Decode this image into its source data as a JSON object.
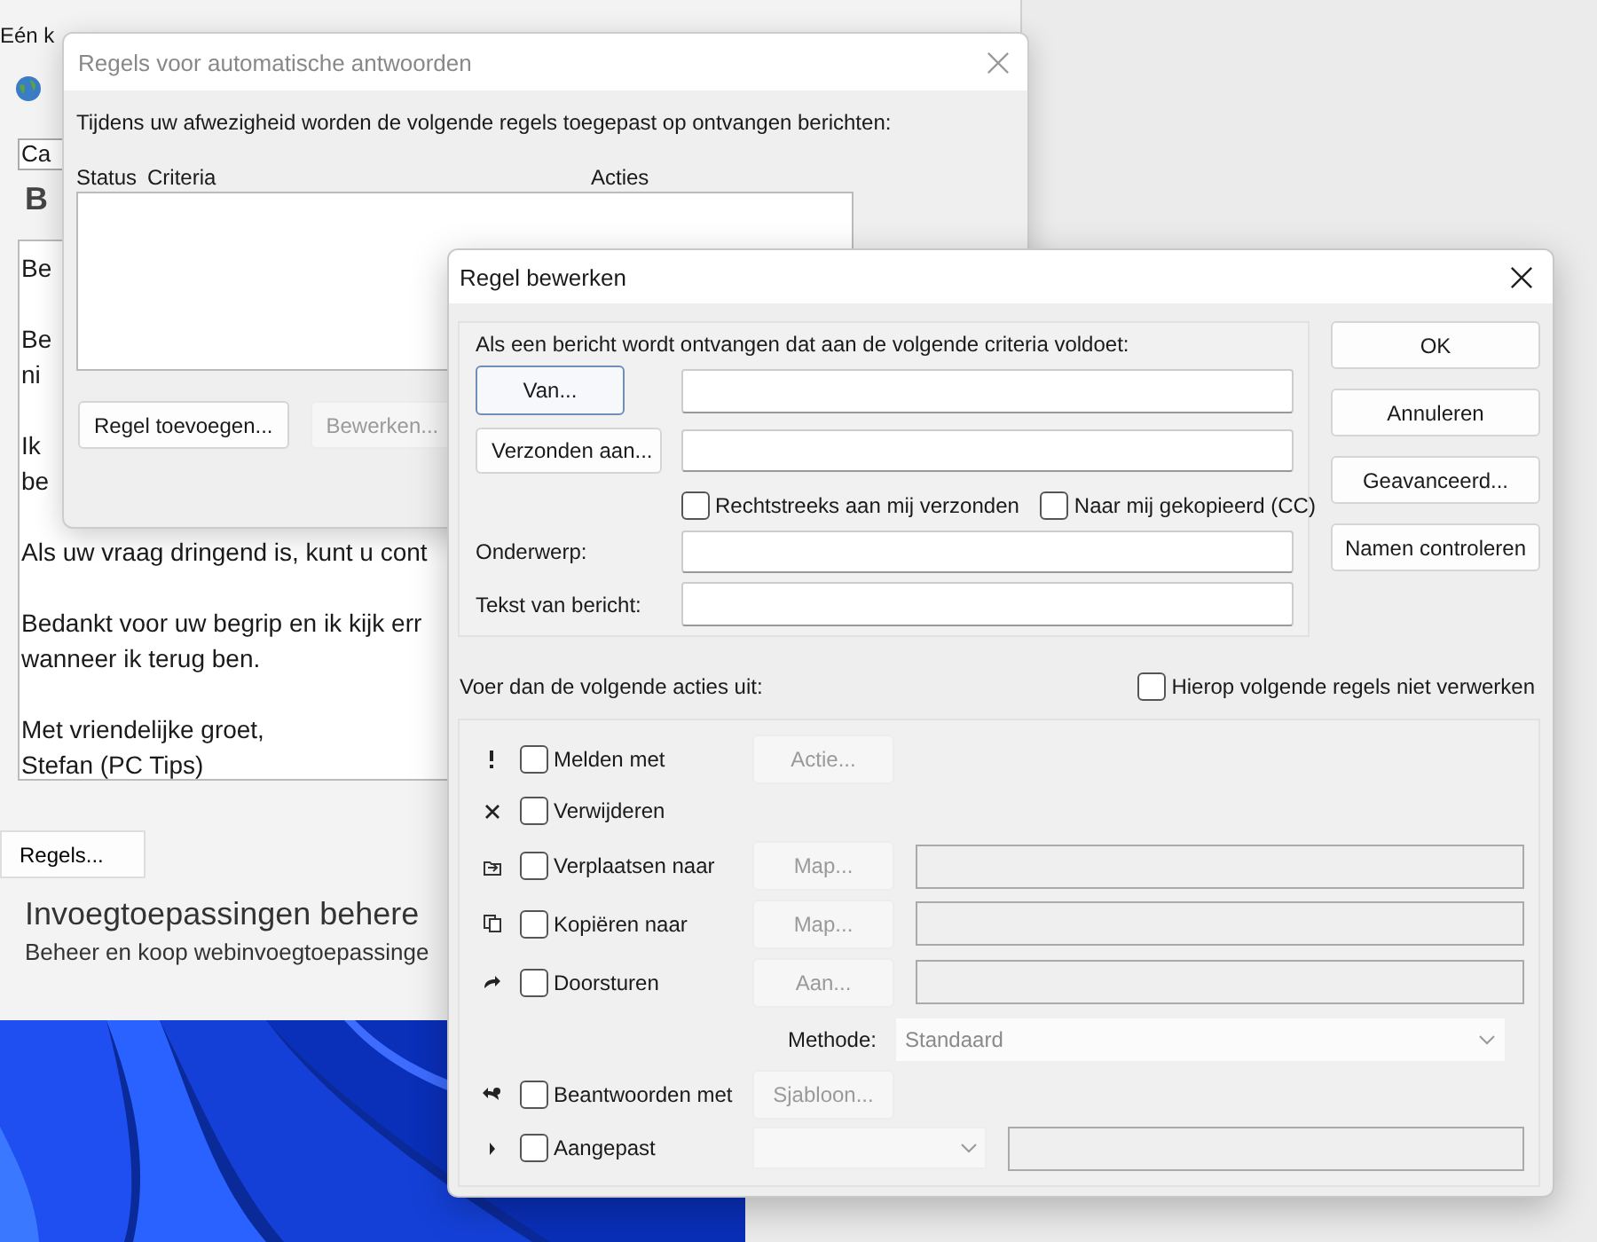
{
  "outlook": {
    "top_text": "Eén k",
    "field_value": "Ca",
    "heading_letter": "B",
    "message_paragraphs": [
      [
        "Be"
      ],
      [
        "Be",
        "ni"
      ],
      [
        "Ik",
        "be"
      ],
      [
        "Als uw vraag dringend is, kunt u cont"
      ],
      [
        "Bedankt voor uw begrip en ik kijk err",
        "wanneer ik terug ben."
      ],
      [
        "Met vriendelijke groet,",
        "Stefan (PC Tips)"
      ]
    ],
    "rules_button": "Regels...",
    "addins_title": "Invoegtoepassingen behere",
    "addins_subtitle": "Beheer en koop webinvoegtoepassinge"
  },
  "auto_reply_dialog": {
    "title": "Regels voor automatische antwoorden",
    "intro": "Tijdens uw afwezigheid worden de volgende regels toegepast op ontvangen berichten:",
    "columns": [
      "Status",
      "Criteria",
      "Acties"
    ],
    "buttons": [
      {
        "label": "Regel toevoegen...",
        "disabled": false
      },
      {
        "label": "Bewerken...",
        "disabled": true
      }
    ]
  },
  "edit_rule_dialog": {
    "title": "Regel bewerken",
    "criteria_heading": "Als een bericht wordt ontvangen dat aan de volgende criteria voldoet:",
    "criteria": [
      {
        "kind": "button_field",
        "button": "Van...",
        "focused": true
      },
      {
        "kind": "button_field",
        "button": "Verzonden aan...",
        "focused": false
      },
      {
        "kind": "checks",
        "options": [
          {
            "label": "Rechtstreeks aan mij verzonden",
            "checked": false
          },
          {
            "label": "Naar mij gekopieerd (CC)",
            "checked": false
          }
        ]
      },
      {
        "kind": "label_field",
        "label": "Onderwerp:"
      },
      {
        "kind": "label_field",
        "label": "Tekst van bericht:"
      }
    ],
    "side_buttons": [
      "OK",
      "Annuleren",
      "Geavanceerd...",
      "Namen controleren"
    ],
    "actions_heading": "Voer dan de volgende acties uit:",
    "stop_processing": {
      "label": "Hierop volgende regels niet verwerken",
      "checked": false
    },
    "actions": [
      {
        "kind": "check",
        "label": "Melden met",
        "checked": false,
        "button": {
          "label": "Actie...",
          "disabled": true
        }
      },
      {
        "kind": "check",
        "label": "Verwijderen",
        "checked": false
      },
      {
        "kind": "check",
        "label": "Verplaatsen naar",
        "checked": false,
        "button": {
          "label": "Map...",
          "disabled": true
        },
        "field": {
          "disabled": true
        }
      },
      {
        "kind": "check",
        "label": "Kopiëren naar",
        "checked": false,
        "button": {
          "label": "Map...",
          "disabled": true
        },
        "field": {
          "disabled": true
        }
      },
      {
        "kind": "check",
        "label": "Doorsturen",
        "checked": false,
        "button": {
          "label": "Aan...",
          "disabled": true
        },
        "field": {
          "disabled": true
        }
      },
      {
        "kind": "select",
        "label": "Methode:",
        "value": "Standaard",
        "disabled": true
      },
      {
        "kind": "check",
        "label": "Beantwoorden met",
        "checked": false,
        "button": {
          "label": "Sjabloon...",
          "disabled": true
        }
      },
      {
        "kind": "check",
        "label": "Aangepast",
        "checked": false,
        "dropdown": {
          "disabled": true
        },
        "field": {
          "disabled": true
        }
      }
    ]
  }
}
